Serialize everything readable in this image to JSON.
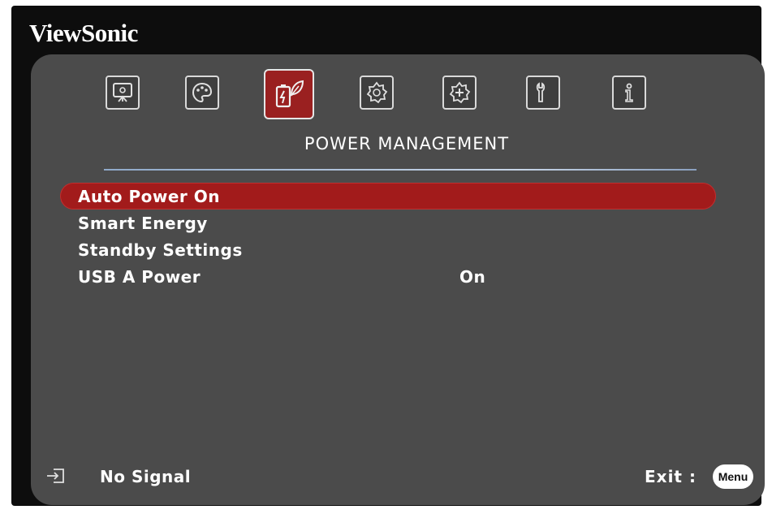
{
  "brand": "ViewSonic",
  "tabs": [
    {
      "name": "display",
      "icon": "display-icon"
    },
    {
      "name": "image",
      "icon": "palette-icon"
    },
    {
      "name": "power-management",
      "icon": "power-leaf-icon",
      "active": true
    },
    {
      "name": "basic",
      "icon": "gear-icon"
    },
    {
      "name": "advanced",
      "icon": "advanced-gear-icon"
    },
    {
      "name": "system",
      "icon": "wrench-icon"
    },
    {
      "name": "information",
      "icon": "info-icon"
    }
  ],
  "section_title": "POWER MANAGEMENT",
  "menu": {
    "items": [
      {
        "label": "Auto Power On",
        "value": "",
        "selected": true
      },
      {
        "label": "Smart Energy",
        "value": ""
      },
      {
        "label": "Standby Settings",
        "value": ""
      },
      {
        "label": "USB A Power",
        "value": "On"
      }
    ]
  },
  "status": {
    "signal": "No Signal",
    "exit_label": "Exit :",
    "menu_button": "Menu",
    "input_icon": "input-source-icon"
  },
  "colors": {
    "background": "#0d0d0d",
    "panel": "#4b4b4b",
    "highlight": "#a21b1b",
    "text": "#ffffff",
    "divider": "#c6d4e6"
  }
}
